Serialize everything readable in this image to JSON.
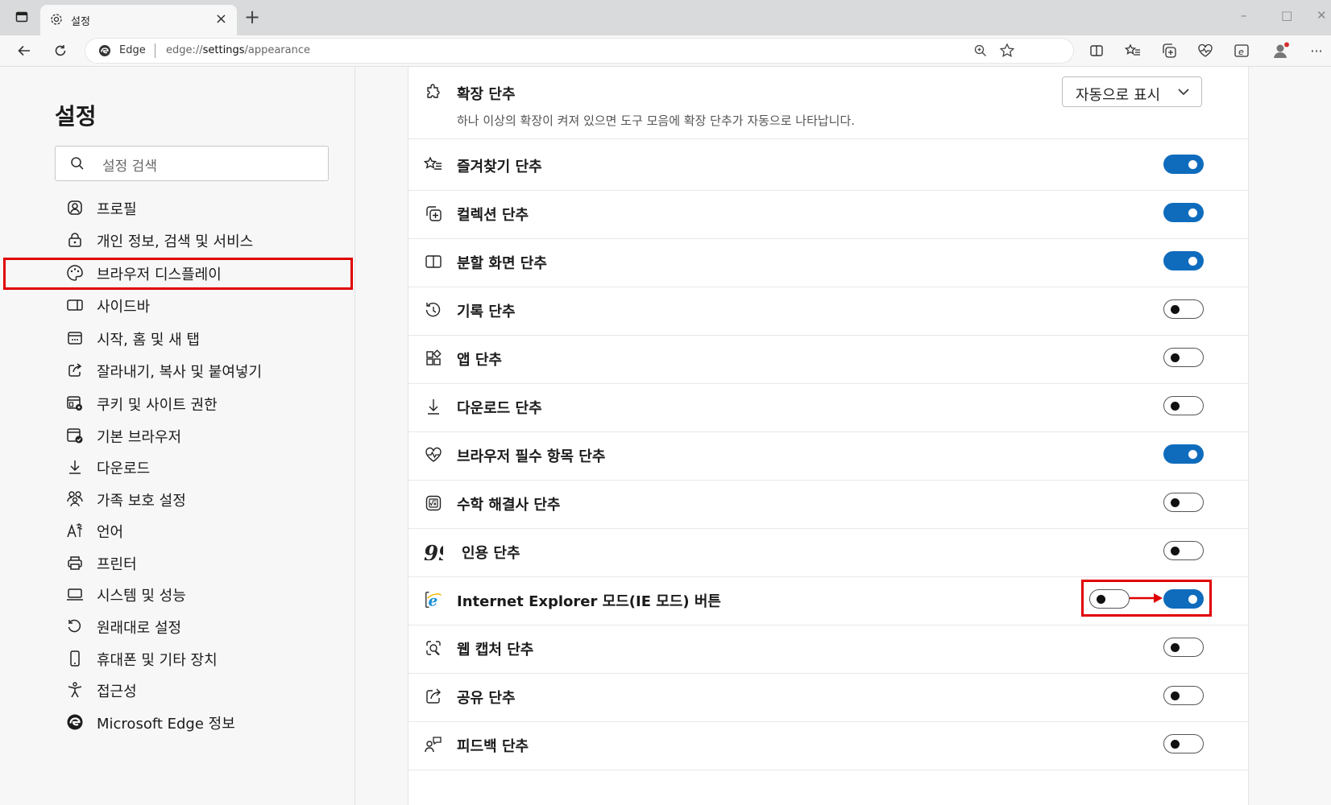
{
  "browser": {
    "tab_title": "설정",
    "tab_close": "×",
    "new_tab": "+",
    "window_min": "–",
    "window_max": "□",
    "window_close": "✕",
    "address_site": "Edge",
    "address_url_prefix": "edge://",
    "address_url_bold": "settings",
    "address_url_suffix": "/appearance",
    "menu": "···"
  },
  "sidebar": {
    "title": "설정",
    "search_placeholder": "설정 검색",
    "items": [
      {
        "label": "프로필",
        "icon": "profile-icon"
      },
      {
        "label": "개인 정보, 검색 및 서비스",
        "icon": "lock-icon"
      },
      {
        "label": "브라우저 디스플레이",
        "icon": "palette-icon",
        "selected": true
      },
      {
        "label": "사이드바",
        "icon": "sidebar-icon"
      },
      {
        "label": "시작, 홈 및 새 탭",
        "icon": "start-page-icon"
      },
      {
        "label": "잘라내기, 복사 및 붙여넣기",
        "icon": "share-icon"
      },
      {
        "label": "쿠키 및 사이트 권한",
        "icon": "cookie-permissions-icon"
      },
      {
        "label": "기본 브라우저",
        "icon": "default-browser-icon"
      },
      {
        "label": "다운로드",
        "icon": "download-icon"
      },
      {
        "label": "가족 보호 설정",
        "icon": "family-icon"
      },
      {
        "label": "언어",
        "icon": "language-icon"
      },
      {
        "label": "프린터",
        "icon": "printer-icon"
      },
      {
        "label": "시스템 및 성능",
        "icon": "laptop-icon"
      },
      {
        "label": "원래대로 설정",
        "icon": "reset-icon"
      },
      {
        "label": "휴대폰 및 기타 장치",
        "icon": "phone-icon"
      },
      {
        "label": "접근성",
        "icon": "accessibility-icon"
      },
      {
        "label": "Microsoft Edge 정보",
        "icon": "edge-logo-icon"
      }
    ]
  },
  "settings": {
    "extensions": {
      "label": "확장 단추",
      "description": "하나 이상의 확장이 켜져 있으면 도구 모음에 확장 단추가 자동으로 나타납니다.",
      "dropdown_value": "자동으로 표시"
    },
    "rows": [
      {
        "label": "즐겨찾기 단추",
        "on": true,
        "icon": "favorites-icon"
      },
      {
        "label": "컬렉션 단추",
        "on": true,
        "icon": "collections-icon"
      },
      {
        "label": "분할 화면 단추",
        "on": true,
        "icon": "split-screen-icon"
      },
      {
        "label": "기록 단추",
        "on": false,
        "icon": "history-icon"
      },
      {
        "label": "앱 단추",
        "on": false,
        "icon": "apps-icon"
      },
      {
        "label": "다운로드 단추",
        "on": false,
        "icon": "download-icon"
      },
      {
        "label": "브라우저 필수 항목 단추",
        "on": true,
        "icon": "heart-pulse-icon"
      },
      {
        "label": "수학 해결사 단추",
        "on": false,
        "icon": "math-solver-icon"
      },
      {
        "label": "인용 단추",
        "on": false,
        "icon": "quote-icon"
      },
      {
        "label": "Internet Explorer 모드(IE 모드) 버튼",
        "on": true,
        "was_on": false,
        "icon": "ie-icon"
      },
      {
        "label": "웹 캡처 단추",
        "on": false,
        "icon": "web-capture-icon"
      },
      {
        "label": "공유 단추",
        "on": false,
        "icon": "share-icon"
      },
      {
        "label": "피드백 단추",
        "on": false,
        "icon": "feedback-icon"
      }
    ]
  },
  "colors": {
    "accent": "#0f6cbd",
    "highlight_red": "#e00000"
  }
}
